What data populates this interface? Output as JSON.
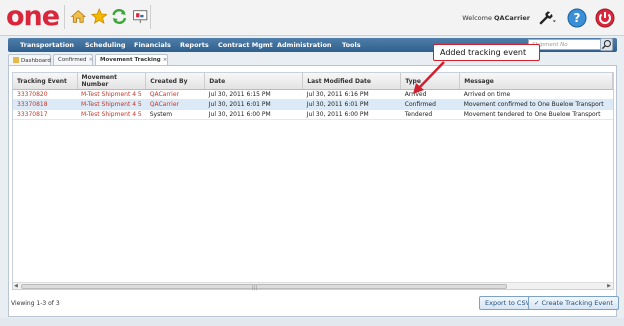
{
  "app": {
    "logo_text": "one",
    "welcome_prefix": "Welcome ",
    "username": "QACarrier",
    "brand_color": "#d9263b"
  },
  "menu": {
    "items": [
      "Transportation",
      "Scheduling",
      "Financials",
      "Reports",
      "Contract Mgmt",
      "Administration",
      "Tools"
    ]
  },
  "search": {
    "placeholder": "Shipment No"
  },
  "tabs": [
    {
      "label": "Dashboard",
      "active": false
    },
    {
      "label": "Confirmed",
      "active": false
    },
    {
      "label": "Movement Tracking",
      "active": true
    }
  ],
  "grid": {
    "columns": [
      "Tracking Event",
      "Movement Number",
      "Created By",
      "Date",
      "Last Modified Date",
      "Type",
      "Message"
    ],
    "rows": [
      [
        "33370820",
        "M-Test Shipment 4 5",
        "QACarrier",
        "Jul 30, 2011 6:15 PM",
        "Jul 30, 2011 6:16 PM",
        "Arrived",
        "Arrived on time"
      ],
      [
        "33370818",
        "M-Test Shipment 4 5",
        "QACarrier",
        "Jul 30, 2011 6:01 PM",
        "Jul 30, 2011 6:01 PM",
        "Confirmed",
        "Movement confirmed to One Buelow Transport"
      ],
      [
        "33370817",
        "M-Test Shipment 4 5",
        "System",
        "Jul 30, 2011 6:00 PM",
        "Jul 30, 2011 6:00 PM",
        "Tendered",
        "Movement tendered to One Buelow Transport"
      ]
    ]
  },
  "footer": {
    "status": "Viewing 1-3 of 3",
    "export_label": "Export to CSV",
    "create_label": "Create Tracking Event"
  },
  "annotation": {
    "text": "Added tracking event",
    "color": "#d1202e"
  }
}
